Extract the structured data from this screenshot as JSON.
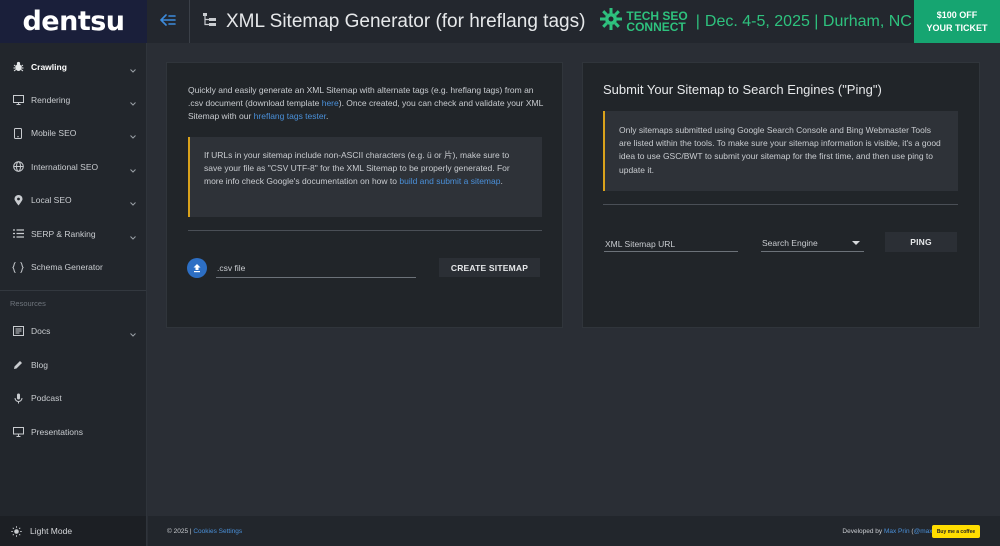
{
  "header": {
    "logo": "dentsu",
    "title": "XML Sitemap Generator (for hreflang tags)",
    "promo": {
      "brand_line1": "TECH SEO",
      "brand_line2": "CONNECT",
      "separator": "|",
      "text": "Dec. 4-5, 2025 | Durham, NC"
    },
    "ticket_line1": "$100 OFF",
    "ticket_line2": "YOUR TICKET"
  },
  "sidebar": {
    "items": [
      {
        "label": "Crawling",
        "icon": "bug-icon"
      },
      {
        "label": "Rendering",
        "icon": "monitor-icon"
      },
      {
        "label": "Mobile SEO",
        "icon": "mobile-icon"
      },
      {
        "label": "International SEO",
        "icon": "globe-icon"
      },
      {
        "label": "Local SEO",
        "icon": "pin-icon"
      },
      {
        "label": "SERP & Ranking",
        "icon": "list-icon"
      },
      {
        "label": "Schema Generator",
        "icon": "braces-icon"
      }
    ],
    "resources_label": "Resources",
    "resources": [
      {
        "label": "Docs",
        "icon": "docs-icon"
      },
      {
        "label": "Blog",
        "icon": "pencil-icon"
      },
      {
        "label": "Podcast",
        "icon": "mic-icon"
      },
      {
        "label": "Presentations",
        "icon": "presentation-icon"
      }
    ],
    "light_mode": "Light Mode"
  },
  "left_card": {
    "intro_1": "Quickly and easily generate an XML Sitemap with alternate tags (e.g. hreflang tags) from an .csv document (download template ",
    "intro_link_here": "here",
    "intro_2": "). Once created, you can check and validate your XML Sitemap with our ",
    "intro_link_tester": "hreflang tags tester",
    "intro_3": ".",
    "note_1": "If URLs in your sitemap include non-ASCII characters (e.g. ü or 片), make sure to save your file as \"CSV UTF-8\" for the XML Sitemap to be properly generated. For more info check Google's documentation on how to ",
    "note_link": "build and submit a sitemap",
    "note_2": ".",
    "file_placeholder": ".csv file",
    "create_button": "CREATE SITEMAP"
  },
  "right_card": {
    "title": "Submit Your Sitemap to Search Engines (\"Ping\")",
    "note": "Only sitemaps submitted using Google Search Console and Bing Webmaster Tools are listed within the tools. To make sure your sitemap information is visible, it's a good idea to use GSC/BWT to submit your sitemap for the first time, and then use ping to update it.",
    "url_placeholder": "XML Sitemap URL",
    "engine_select": "Search Engine",
    "ping_button": "PING"
  },
  "footer": {
    "copyright": "© 2025 | ",
    "cookies": "Cookies Settings",
    "developed_by": "Developed by ",
    "author": "Max Prin",
    "handle_open": " (",
    "handle": "@maxxeight",
    "handle_close": ")",
    "coffee": "Buy me a coffee"
  },
  "colors": {
    "accent_green": "#2ec27e",
    "ticket_bg": "#16a571",
    "link_blue": "#4a90d9",
    "note_border": "#d9a21b"
  }
}
